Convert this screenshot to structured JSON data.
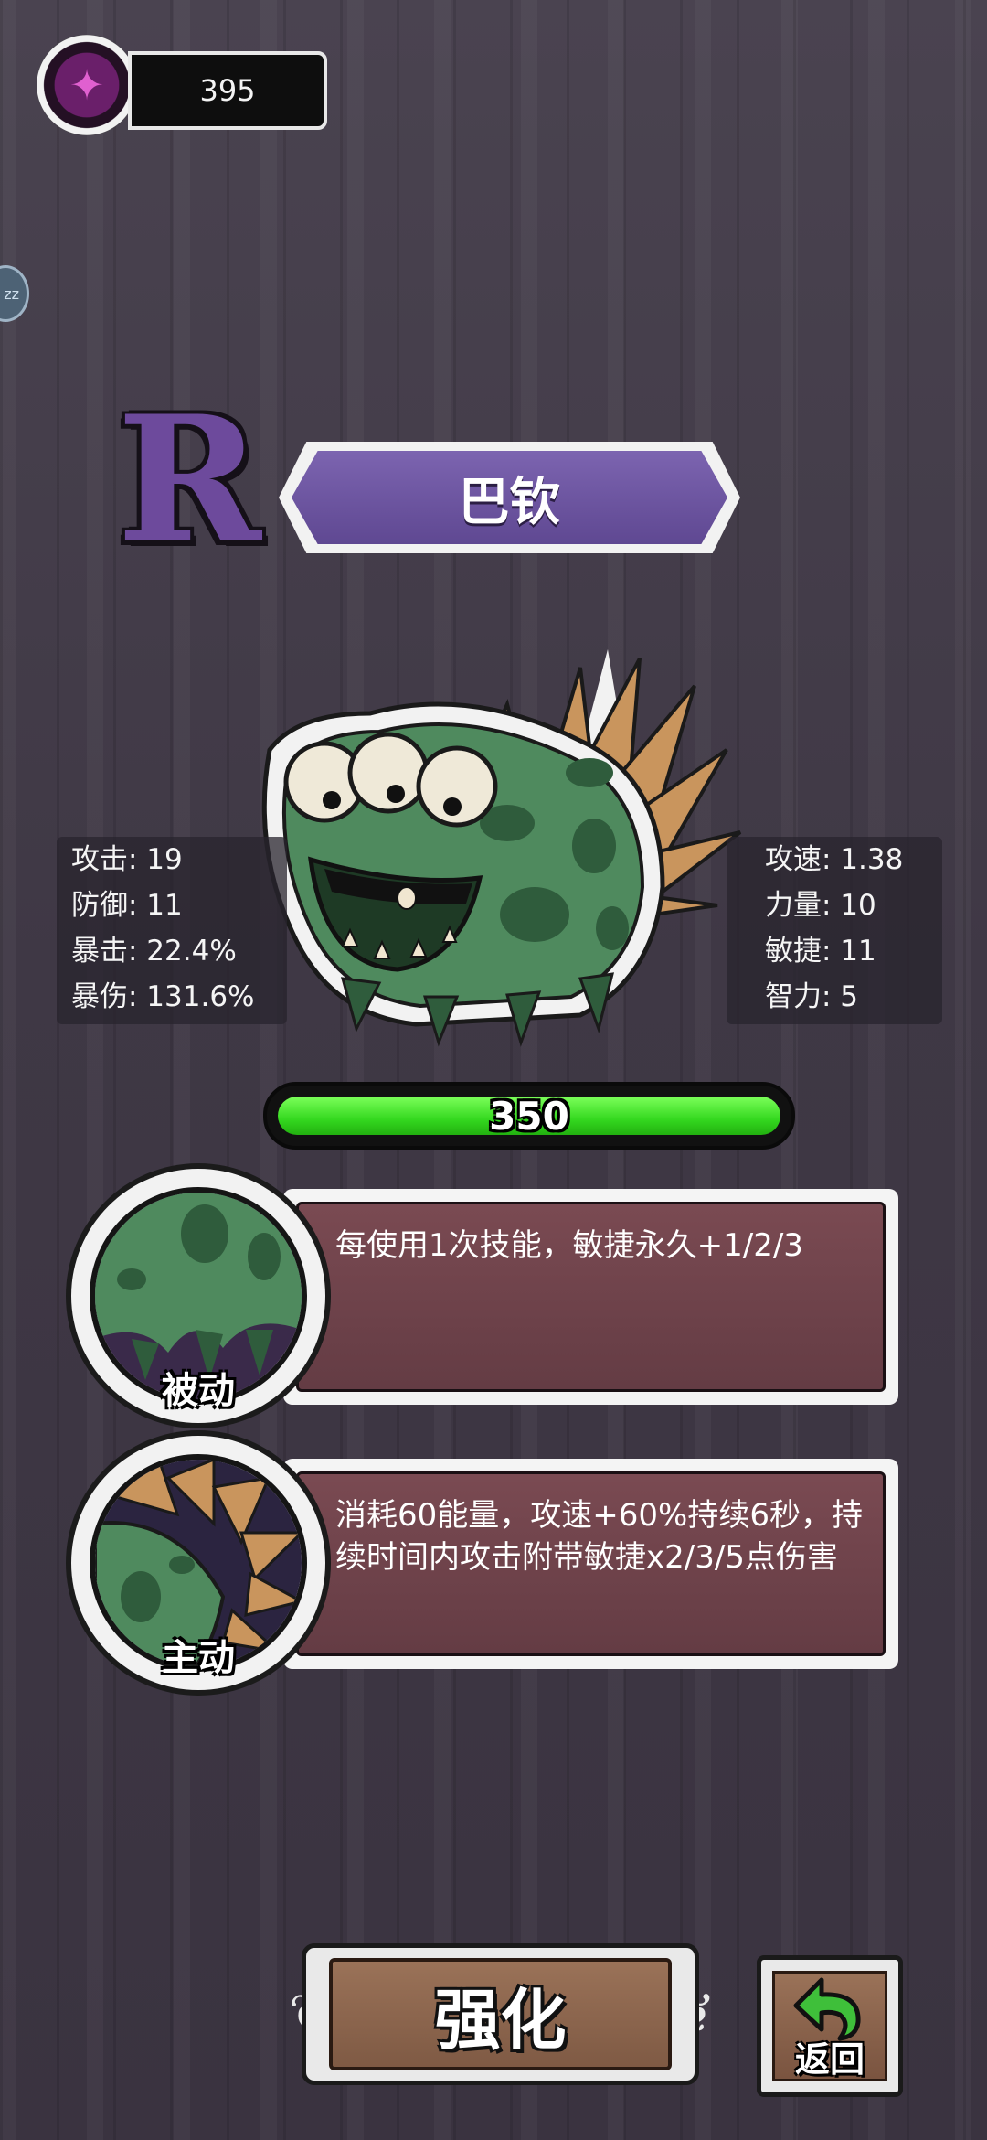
{
  "currency": {
    "icon": "purple-gem-icon",
    "amount": "395"
  },
  "hero": {
    "rarity": "R",
    "name": "巴钦",
    "hp": "350"
  },
  "stats_left": [
    "攻击: 19",
    "防御: 11",
    "暴击: 22.4%",
    "暴伤: 131.6%"
  ],
  "stats_right": [
    "攻速: 1.38",
    "力量: 10",
    "敏捷: 11",
    "智力: 5"
  ],
  "skills": [
    {
      "type": "被动",
      "description": "每使用1次技能，敏捷永久+1/2/3"
    },
    {
      "type": "主动",
      "description": "消耗60能量，攻速+60%持续6秒，持续时间内攻击附带敏捷x2/3/5点伤害"
    }
  ],
  "buttons": {
    "upgrade": "强化",
    "back": "返回"
  },
  "colors": {
    "rarity": "#6d4a9c",
    "hp_fill": "#34d81f",
    "skill_panel": "#6e424a",
    "banner": "#6e56a2"
  }
}
